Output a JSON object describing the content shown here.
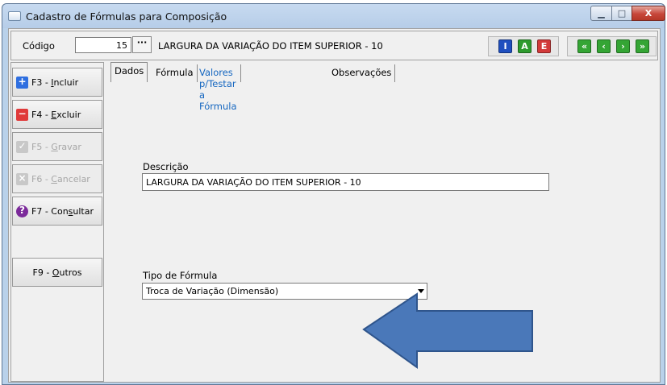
{
  "window": {
    "title": "Cadastro de Fórmulas para Composição",
    "controls": {
      "minimize": "▁",
      "maximize": "□",
      "close": "X"
    }
  },
  "header": {
    "codigo_label": "Código",
    "codigo_value": "15",
    "lookup_label": "···",
    "codigo_description": "LARGURA DA VARIAÇÃO DO ITEM SUPERIOR - 10",
    "mode_buttons": [
      {
        "label": "I",
        "color": "#1f4fbf"
      },
      {
        "label": "A",
        "color": "#2e9b2e"
      },
      {
        "label": "E",
        "color": "#d23a3a"
      }
    ],
    "nav_buttons": [
      {
        "label": "«",
        "icon": "first-record-icon"
      },
      {
        "label": "‹",
        "icon": "previous-record-icon"
      },
      {
        "label": "›",
        "icon": "next-record-icon"
      },
      {
        "label": "»",
        "icon": "last-record-icon"
      }
    ],
    "nav_color": "#34a534"
  },
  "sidebar": {
    "buttons": [
      {
        "prefix": "F3 - ",
        "key": "I",
        "rest": "ncluir",
        "icon": "+",
        "icon_color": "#2f6fe0"
      },
      {
        "prefix": "F4 - ",
        "key": "E",
        "rest": "xcluir",
        "icon": "−",
        "icon_color": "#e03a3a"
      },
      {
        "prefix": "F5 - ",
        "key": "G",
        "rest": "ravar",
        "icon": "✓",
        "icon_color": "#c8c8c8"
      },
      {
        "prefix": "F6 - ",
        "key": "C",
        "rest": "ancelar",
        "icon": "×",
        "icon_color": "#c8c8c8"
      },
      {
        "prefix": "F7 - Con",
        "key": "s",
        "rest": "ultar",
        "icon": "?",
        "icon_color": "#7b2a9a"
      },
      {
        "prefix": "F9 - ",
        "key": "O",
        "rest": "utros"
      }
    ]
  },
  "tabs": [
    "Dados",
    "Fórmula",
    "Valores p/Testar a Fórmula",
    "Observações"
  ],
  "form": {
    "descricao_label": "Descrição",
    "descricao_value": "LARGURA DA VARIAÇÃO DO ITEM SUPERIOR - 10",
    "tipo_label": "Tipo de Fórmula",
    "tipo_value": "Troca de Variação (Dimensão)"
  },
  "annotation": {
    "arrow_color": "#4a78b9",
    "arrow_border": "#2f558c",
    "direction": "left"
  }
}
